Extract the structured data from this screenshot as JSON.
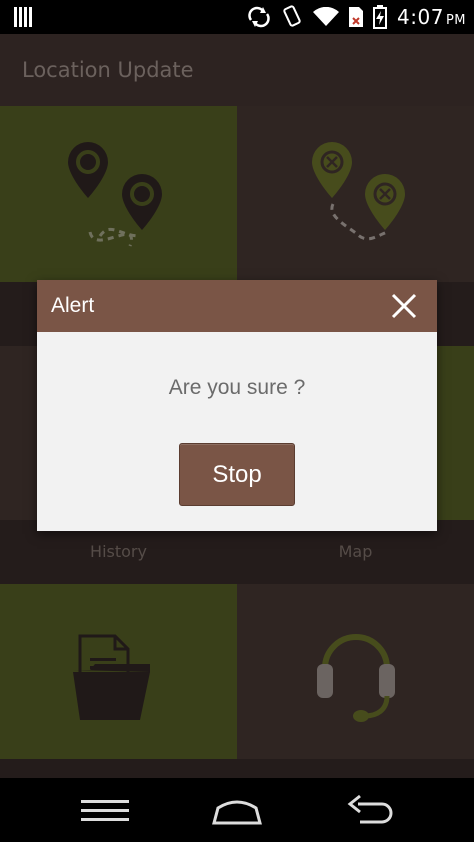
{
  "status_bar": {
    "time": "4:07",
    "ampm": "PM",
    "icons": [
      "sim-icon",
      "sync-icon",
      "rotate-icon",
      "wifi-icon",
      "no-sim-icon",
      "battery-charging-icon"
    ]
  },
  "app": {
    "title": "Location Update",
    "tiles": [
      {
        "id": "start",
        "icon": "location-pins-icon",
        "label": ""
      },
      {
        "id": "stop",
        "icon": "location-pins-cancel-icon",
        "label": ""
      },
      {
        "id": "history",
        "icon": "history-icon",
        "label": "History"
      },
      {
        "id": "map",
        "icon": "map-icon",
        "label": "Map"
      },
      {
        "id": "files",
        "icon": "folder-file-icon",
        "label": ""
      },
      {
        "id": "support",
        "icon": "headset-icon",
        "label": ""
      }
    ]
  },
  "dialog": {
    "title": "Alert",
    "message": "Are you sure ?",
    "button_label": "Stop"
  },
  "nav_bar": {
    "buttons": [
      "menu-icon",
      "home-icon",
      "back-icon"
    ]
  },
  "colors": {
    "green_tile": "#4a5121",
    "dark_tile": "#3d302c",
    "accent_brown": "#7a5546",
    "icon_dark": "#2a211f",
    "icon_green": "#5b6225"
  }
}
